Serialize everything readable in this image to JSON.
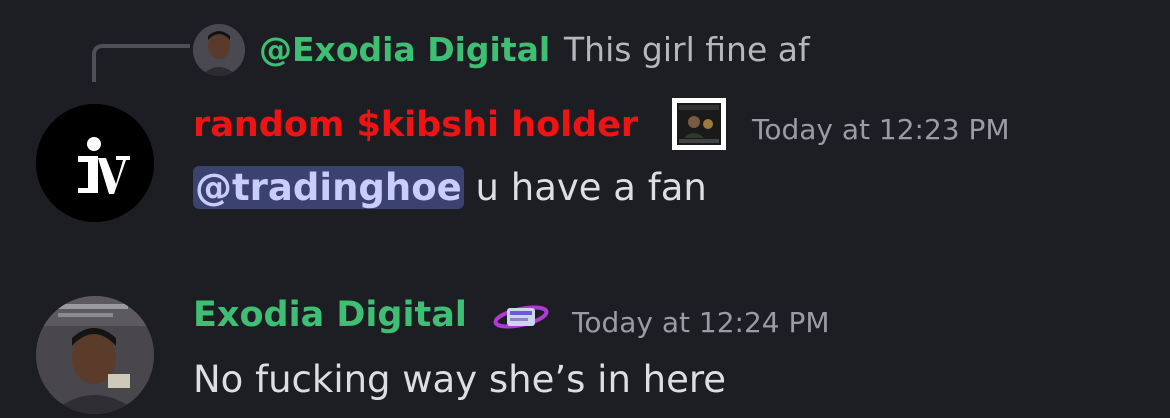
{
  "reply": {
    "author": "@Exodia Digital",
    "text": "This girl fine af"
  },
  "messages": [
    {
      "author": "random $kibshi holder",
      "timestamp": "Today at 12:23 PM",
      "mention": "@tradinghoe",
      "text": " u have a fan",
      "author_color": "#f01313"
    },
    {
      "author": "Exodia Digital",
      "timestamp": "Today at 12:24 PM",
      "text": "No fucking way she’s in here",
      "author_color": "#3fbf73"
    }
  ],
  "colors": {
    "background": "#1d1e23",
    "mention_bg": "#3c4270",
    "mention_fg": "#c9cdfb"
  }
}
